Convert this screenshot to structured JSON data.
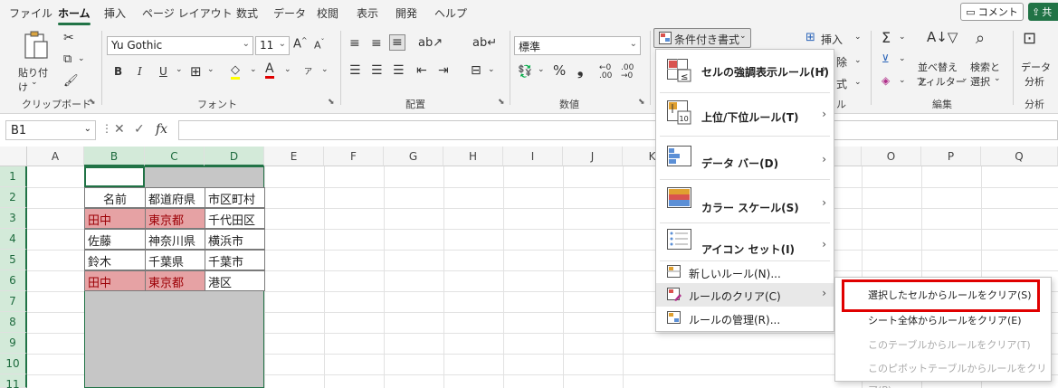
{
  "menu_tabs": [
    "ファイル",
    "ホーム",
    "挿入",
    "ページ レイアウト",
    "数式",
    "データ",
    "校閲",
    "表示",
    "開発",
    "ヘルプ"
  ],
  "active_tab": "ホーム",
  "comment_label": "コメント",
  "share_label": "共",
  "ribbon": {
    "paste_label": "貼り付け",
    "clipboard_group": "クリップボード",
    "font_name": "Yu Gothic",
    "font_size": "11",
    "font_group": "フォント",
    "bold": "B",
    "italic": "I",
    "underline": "U",
    "align_group": "配置",
    "number_format": "標準",
    "number_group": "数値",
    "percent": "%",
    "comma": "❟",
    "cond_format_label": "条件付き書式",
    "insert_label": "挿入",
    "delete_label_partial": "除",
    "format_label_partial": "式",
    "cells_group_partial": "ル",
    "sort_filter_label_1": "並べ替えと",
    "sort_filter_label_2": "フィルター",
    "find_select_label_1": "検索と",
    "find_select_label_2": "選択",
    "edit_group": "編集",
    "analyze_label_1": "データ",
    "analyze_label_2": "分析",
    "analyze_group": "分析"
  },
  "formula_bar": {
    "name_box": "B1",
    "fx": "fx",
    "value": ""
  },
  "columns": [
    "A",
    "B",
    "C",
    "D",
    "E",
    "F",
    "G",
    "H",
    "I",
    "J",
    "K",
    "",
    "",
    "",
    "O",
    "P",
    "Q"
  ],
  "rows": [
    "1",
    "2",
    "3",
    "4",
    "5",
    "6",
    "7",
    "8",
    "9",
    "10",
    "11"
  ],
  "table": [
    [
      "名前",
      "都道府県",
      "市区町村"
    ],
    [
      "田中",
      "東京都",
      "千代田区"
    ],
    [
      "佐藤",
      "神奈川県",
      "横浜市"
    ],
    [
      "鈴木",
      "千葉県",
      "千葉市"
    ],
    [
      "田中",
      "東京都",
      "港区"
    ]
  ],
  "dropdown": {
    "items": [
      {
        "label": "セルの強調表示ルール(H)",
        "bold": true,
        "submenu": true
      },
      {
        "label": "上位/下位ルール(T)",
        "bold": true,
        "submenu": true
      },
      {
        "label": "データ バー(D)",
        "bold": true,
        "submenu": true
      },
      {
        "label": "カラー スケール(S)",
        "bold": true,
        "submenu": true
      },
      {
        "label": "アイコン セット(I)",
        "bold": true,
        "submenu": true
      },
      {
        "label": "新しいルール(N)...",
        "bold": false,
        "submenu": false
      },
      {
        "label": "ルールのクリア(C)",
        "bold": false,
        "submenu": true
      },
      {
        "label": "ルールの管理(R)...",
        "bold": false,
        "submenu": false
      }
    ]
  },
  "submenu": {
    "items": [
      {
        "label": "選択したセルからルールをクリア(S)",
        "disabled": false
      },
      {
        "label": "シート全体からルールをクリア(E)",
        "disabled": false
      },
      {
        "label": "このテーブルからルールをクリア(T)",
        "disabled": true
      },
      {
        "label": "このピボットテーブルからルールをクリア(P)",
        "disabled": true
      }
    ]
  },
  "colors": {
    "accent": "#217346",
    "highlight_fill": "#e6a2a4",
    "highlight_text": "#9c0006",
    "annotation": "#e00000"
  }
}
